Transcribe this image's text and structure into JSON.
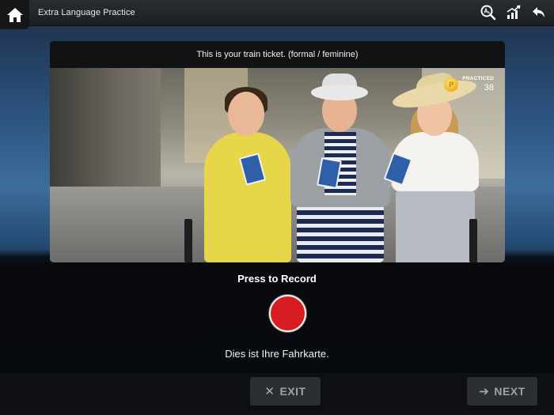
{
  "header": {
    "title": "Extra Language Practice",
    "icons": [
      "home-icon",
      "dictionary-icon",
      "stats-icon",
      "back-arrow-icon"
    ]
  },
  "card": {
    "prompt": "This is your train ticket. (formal / feminine)",
    "practiced_label": "PRACTICED",
    "practiced_count": "38",
    "coin_symbol": "P"
  },
  "record": {
    "title": "Press to Record",
    "answer": "Dies ist Ihre Fahrkarte."
  },
  "footer": {
    "exit_symbol": "✕",
    "exit_label": "EXIT",
    "next_symbol": "➔",
    "next_label": "NEXT"
  },
  "colors": {
    "record_red": "#d51d22",
    "coin_gold": "#f0b417"
  }
}
